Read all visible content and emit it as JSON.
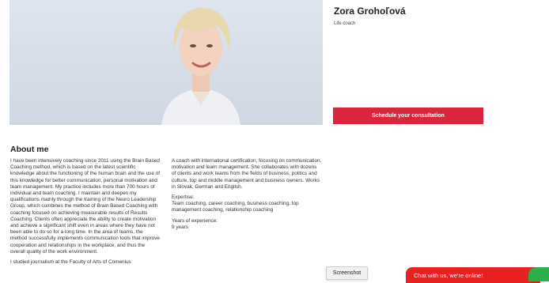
{
  "profile": {
    "name": "Zora Grohoľová",
    "role": "Life coach",
    "cta_label": "Schedule your consultation"
  },
  "about": {
    "title": "About me",
    "col1": [
      "I have been intensively coaching since 2011 using the Brain Based Coaching method, which is based on the latest scientific knowledge about the functioning of the human brain and the use of this knowledge for better communication, personal motivation and team management. My practice includes more than 700 hours of individual and team coaching. I maintain and deepen my qualifications mainly through the training of the Neuro Leadership Group, which combines the method of Brain Based Coaching with coaching focused on achieving measurable results of Results Coaching. Clients often appreciate the ability to create motivation and achieve a significant shift even in areas where they have not been able to do so for a long time. In the area of teams, the method successfully implements communication tools that improve cooperation and relationships in the workplace, and thus the overall quality of the work environment.",
      "I studied journalism at the Faculty of Arts of Comenius"
    ],
    "col2_intro": "A coach with international certification, focusing on communication, motivation and learn management. She collaborates with dozens of clients and work teams from the fields of business, politics and culture, top and middle management and business owners. Works in Slovak, German and English.",
    "expertise_label": "Expertise:",
    "expertise_value": "Team coaching, career coaching, business coaching, top management coaching, relationship coaching",
    "experience_label": "Years of experience:",
    "experience_value": "9 years"
  },
  "overlay": {
    "screenshot_tip": "Screenshot",
    "chat_label": "Chat with us, we're online!"
  },
  "colors": {
    "accent": "#d9263c",
    "chat": "#e8221f",
    "chat_bubble": "#2bb04a"
  }
}
